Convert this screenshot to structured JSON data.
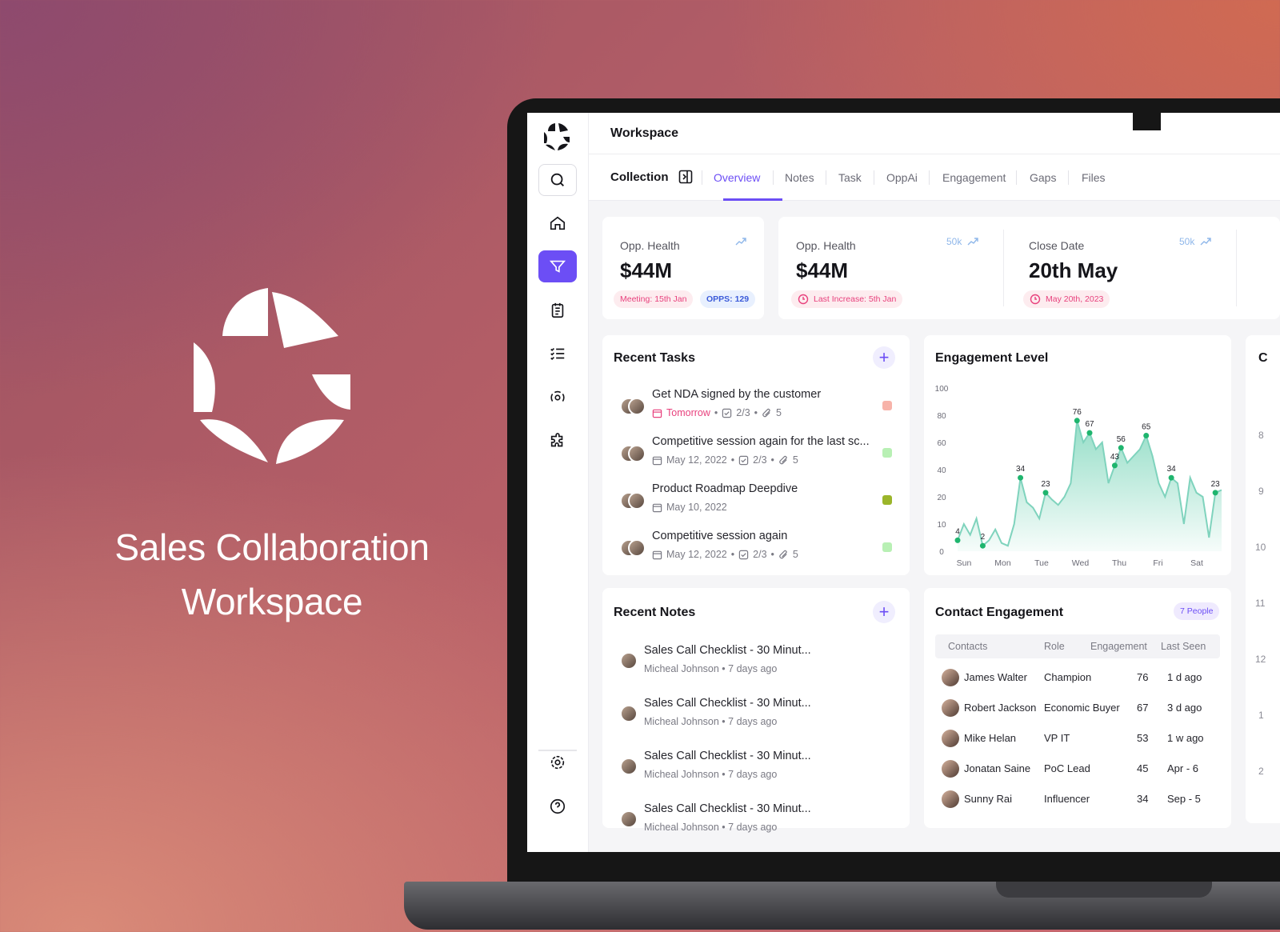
{
  "brand": {
    "title_line1": "Sales Collaboration",
    "title_line2": "Workspace"
  },
  "topbar": {
    "title": "Workspace"
  },
  "collection_label": "Collection",
  "tabs": [
    {
      "label": "Overview",
      "active": true
    },
    {
      "label": "Notes"
    },
    {
      "label": "Task"
    },
    {
      "label": "OppAi"
    },
    {
      "label": "Engagement"
    },
    {
      "label": "Gaps"
    },
    {
      "label": "Files"
    }
  ],
  "kpis": [
    {
      "label": "Opp. Health",
      "value": "$44M",
      "trend": "",
      "pills": [
        "Meeting: 15th Jan",
        "OPPS: 129"
      ]
    },
    {
      "label": "Opp. Health",
      "value": "$44M",
      "trend": "50k",
      "pills": [
        "Last Increase: 5th Jan"
      ]
    },
    {
      "label": "Close Date",
      "value": "20th May",
      "trend": "50k",
      "pills": [
        "May 20th, 2023"
      ]
    }
  ],
  "recent_tasks": {
    "title": "Recent Tasks",
    "add": "+",
    "items": [
      {
        "name": "Get NDA signed by the customer",
        "due": "Tomorrow",
        "checks": "2/3",
        "attachments": "5",
        "flag": "#f7b3a9"
      },
      {
        "name": "Competitive session again for the last sc...",
        "due": "May 12, 2022",
        "checks": "2/3",
        "attachments": "5",
        "flag": "#b8f0b4"
      },
      {
        "name": "Product Roadmap Deepdive",
        "due": "May 10, 2022",
        "checks": "",
        "attachments": "",
        "flag": "#9bb52a"
      },
      {
        "name": "Competitive session again",
        "due": "May 12, 2022",
        "checks": "2/3",
        "attachments": "5",
        "flag": "#b8f0b4"
      }
    ]
  },
  "recent_notes": {
    "title": "Recent Notes",
    "add": "+",
    "items": [
      {
        "title": "Sales Call Checklist - 30 Minut...",
        "author": "Micheal Johnson",
        "when": "7 days ago"
      },
      {
        "title": "Sales Call Checklist - 30 Minut...",
        "author": "Micheal Johnson",
        "when": "7 days ago"
      },
      {
        "title": "Sales Call Checklist - 30 Minut...",
        "author": "Micheal Johnson",
        "when": "7 days ago"
      },
      {
        "title": "Sales Call Checklist - 30 Minut...",
        "author": "Micheal Johnson",
        "when": "7 days ago"
      }
    ]
  },
  "contact_engagement": {
    "title": "Contact Engagement",
    "badge": "7 People",
    "columns": [
      "Contacts",
      "Role",
      "Engagement",
      "Last Seen"
    ],
    "rows": [
      {
        "name": "James Walter",
        "role": "Champion",
        "engagement": "76",
        "last_seen": "1 d ago"
      },
      {
        "name": "Robert Jackson",
        "role": "Economic Buyer",
        "engagement": "67",
        "last_seen": "3 d ago"
      },
      {
        "name": "Mike Helan",
        "role": "VP IT",
        "engagement": "53",
        "last_seen": "1 w ago"
      },
      {
        "name": "Jonatan Saine",
        "role": "PoC Lead",
        "engagement": "45",
        "last_seen": "Apr - 6"
      },
      {
        "name": "Sunny Rai",
        "role": "Influencer",
        "engagement": "34",
        "last_seen": "Sep - 5"
      }
    ]
  },
  "partial_axis_labels": [
    "8",
    "9",
    "10",
    "11",
    "12",
    "1",
    "2"
  ],
  "colors": {
    "accent": "#6c4ef5",
    "pink": "#e8417d",
    "chart_fill": "#8fdcc4",
    "chart_line": "#7fd3bd",
    "chart_point": "#1fb56e"
  },
  "chart_data": {
    "type": "area",
    "title": "Engagement Level",
    "x_categories": [
      "Sun",
      "Mon",
      "Tue",
      "Wed",
      "Thu",
      "Fri",
      "Sat"
    ],
    "y_ticks": [
      0,
      10,
      20,
      40,
      60,
      80,
      100
    ],
    "ylim": [
      0,
      100
    ],
    "series": [
      {
        "values": [
          4,
          10,
          6,
          12,
          2,
          4,
          8,
          3,
          2,
          10,
          34,
          18,
          16,
          12,
          23,
          19,
          17,
          20,
          30,
          76,
          60,
          67,
          55,
          60,
          30,
          43,
          56,
          45,
          50,
          55,
          65,
          50,
          30,
          20,
          34,
          30,
          10,
          34,
          23,
          20,
          5,
          23,
          25
        ]
      }
    ],
    "annotated_points": [
      {
        "index": 0,
        "value": 4
      },
      {
        "index": 4,
        "value": 2
      },
      {
        "index": 10,
        "value": 34
      },
      {
        "index": 14,
        "value": 23
      },
      {
        "index": 19,
        "value": 76
      },
      {
        "index": 21,
        "value": 67
      },
      {
        "index": 25,
        "value": 43
      },
      {
        "index": 26,
        "value": 56
      },
      {
        "index": 30,
        "value": 65
      },
      {
        "index": 34,
        "value": 34
      },
      {
        "index": 41,
        "value": 23
      }
    ]
  }
}
